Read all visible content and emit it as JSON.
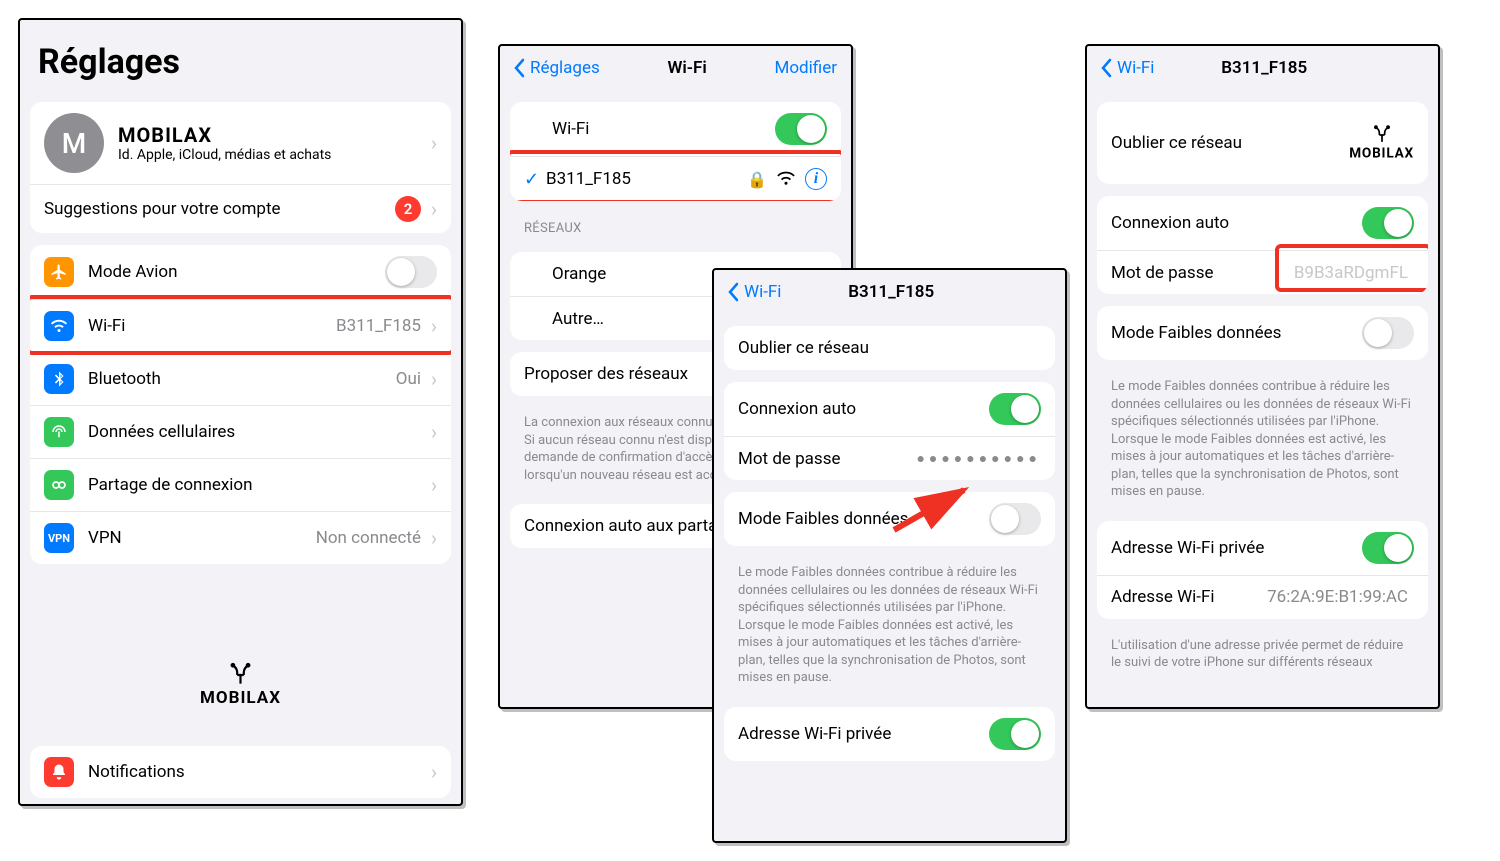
{
  "brand": "MOBILAX",
  "panel1": {
    "title": "Réglages",
    "account": {
      "initial": "M",
      "name": "MOBILAX",
      "sub": "Id. Apple, iCloud, médias et achats"
    },
    "suggestions": {
      "label": "Suggestions pour votre compte",
      "badge": "2"
    },
    "rows": {
      "airplane": {
        "label": "Mode Avion"
      },
      "wifi": {
        "label": "Wi-Fi",
        "value": "B311_F185"
      },
      "bluetooth": {
        "label": "Bluetooth",
        "value": "Oui"
      },
      "cellular": {
        "label": "Données cellulaires"
      },
      "hotspot": {
        "label": "Partage de connexion"
      },
      "vpn": {
        "label": "VPN",
        "value": "Non connecté"
      },
      "notifications": {
        "label": "Notifications"
      }
    }
  },
  "panel2": {
    "back": "Réglages",
    "title": "Wi-Fi",
    "edit": "Modifier",
    "wifiLabel": "Wi-Fi",
    "connectedNetwork": "B311_F185",
    "networksHeader": "RÉSEAUX",
    "networks": [
      "Orange",
      "Autre…"
    ],
    "proposeLabel": "Proposer des réseaux",
    "proposeCaption": "La connexion aux réseaux connus est automatique. Si aucun réseau connu n'est disponible, une demande de confirmation d'accès est envoyée lorsqu'un nouveau réseau est accessible.",
    "autoJoinLabel": "Connexion auto aux partages"
  },
  "panel3": {
    "back": "Wi-Fi",
    "title": "B311_F185",
    "forget": "Oublier ce réseau",
    "autoLabel": "Connexion auto",
    "passwordLabel": "Mot de passe",
    "lowDataLabel": "Mode Faibles données",
    "lowDataCaption": "Le mode Faibles données contribue à réduire les données cellulaires ou les données de réseaux Wi-Fi spécifiques sélectionnés utilisées par l'iPhone. Lorsque le mode Faibles données est activé, les mises à jour automatiques et les tâches d'arrière-plan, telles que la synchronisation de Photos, sont mises en pause.",
    "privateWifiLabel": "Adresse Wi-Fi privée"
  },
  "panel4": {
    "back": "Wi-Fi",
    "title": "B311_F185",
    "forget": "Oublier ce réseau",
    "autoLabel": "Connexion auto",
    "passwordLabel": "Mot de passe",
    "passwordValue": "B9B3aRDgmFL",
    "lowDataLabel": "Mode Faibles données",
    "lowDataCaption": "Le mode Faibles données contribue à réduire les données cellulaires ou les données de réseaux Wi-Fi spécifiques sélectionnés utilisées par l'iPhone. Lorsque le mode Faibles données est activé, les mises à jour automatiques et les tâches d'arrière-plan, telles que la synchronisation de Photos, sont mises en pause.",
    "privateWifiLabel": "Adresse Wi-Fi privée",
    "wifiAddrLabel": "Adresse Wi-Fi",
    "wifiAddrValue": "76:2A:9E:B1:99:AC",
    "privateCaption": "L'utilisation d'une adresse privée permet de réduire le suivi de votre iPhone sur différents réseaux"
  }
}
